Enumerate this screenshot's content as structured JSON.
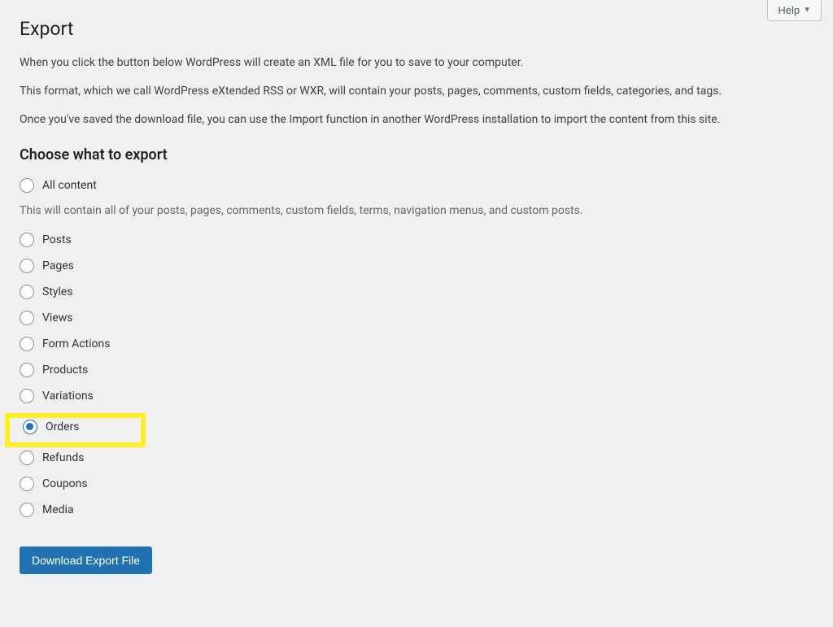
{
  "help_button": "Help",
  "page_title": "Export",
  "description": [
    "When you click the button below WordPress will create an XML file for you to save to your computer.",
    "This format, which we call WordPress eXtended RSS or WXR, will contain your posts, pages, comments, custom fields, categories, and tags.",
    "Once you've saved the download file, you can use the Import function in another WordPress installation to import the content from this site."
  ],
  "subheading": "Choose what to export",
  "all_content_hint": "This will contain all of your posts, pages, comments, custom fields, terms, navigation menus, and custom posts.",
  "options": {
    "all": "All content",
    "posts": "Posts",
    "pages": "Pages",
    "styles": "Styles",
    "views": "Views",
    "form_actions": "Form Actions",
    "products": "Products",
    "variations": "Variations",
    "orders": "Orders",
    "refunds": "Refunds",
    "coupons": "Coupons",
    "media": "Media"
  },
  "download_button": "Download Export File"
}
